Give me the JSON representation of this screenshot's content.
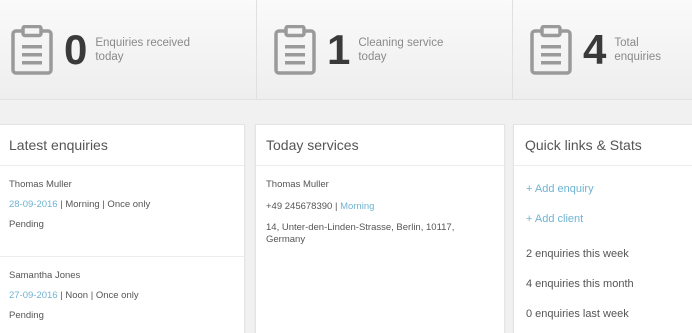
{
  "stats": [
    {
      "number": "0",
      "label": "Enquiries received today"
    },
    {
      "number": "1",
      "label": "Cleaning service today"
    },
    {
      "number": "4",
      "label": "Total enquiries"
    }
  ],
  "latest_enquiries": {
    "title": "Latest enquiries",
    "items": [
      {
        "name": "Thomas Muller",
        "date": "28-09-2016",
        "details": " | Morning | Once only",
        "status": "Pending"
      },
      {
        "name": "Samantha Jones",
        "date": "27-09-2016",
        "details": " | Noon | Once only",
        "status": "Pending"
      }
    ]
  },
  "today_services": {
    "title": "Today services",
    "items": [
      {
        "name": "Thomas Muller",
        "phone": "+49 245678390 | ",
        "time": "Morning",
        "address": "14, Unter-den-Linden-Strasse, Berlin, 10117, Germany"
      }
    ]
  },
  "quick_links": {
    "title": "Quick links & Stats",
    "links": [
      "+ Add enquiry",
      "+ Add client"
    ],
    "stats": [
      "2 enquiries this week",
      "4 enquiries this month",
      "0 enquiries last week"
    ]
  },
  "colors": {
    "accent": "#6fb3d2",
    "icon": "#9a9a9a"
  }
}
